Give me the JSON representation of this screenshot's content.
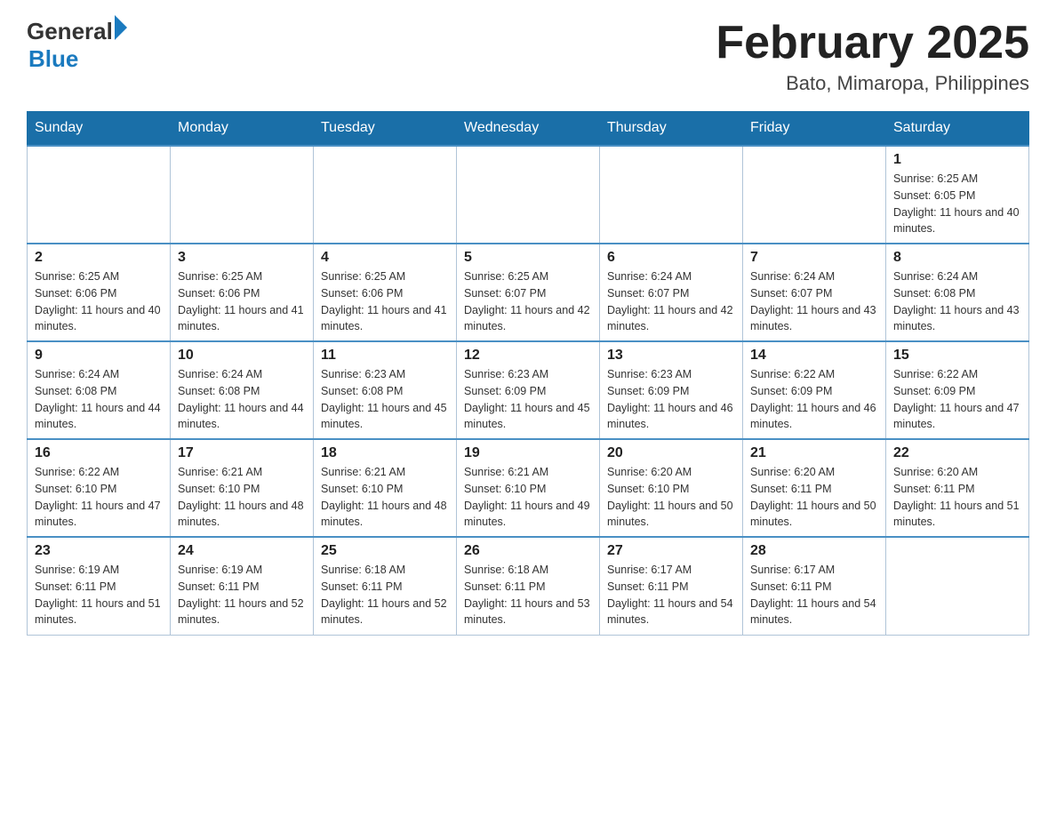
{
  "header": {
    "logo": {
      "general": "General",
      "blue": "Blue"
    },
    "title": "February 2025",
    "location": "Bato, Mimaropa, Philippines"
  },
  "days_of_week": [
    "Sunday",
    "Monday",
    "Tuesday",
    "Wednesday",
    "Thursday",
    "Friday",
    "Saturday"
  ],
  "weeks": [
    [
      {
        "day": "",
        "sunrise": "",
        "sunset": "",
        "daylight": ""
      },
      {
        "day": "",
        "sunrise": "",
        "sunset": "",
        "daylight": ""
      },
      {
        "day": "",
        "sunrise": "",
        "sunset": "",
        "daylight": ""
      },
      {
        "day": "",
        "sunrise": "",
        "sunset": "",
        "daylight": ""
      },
      {
        "day": "",
        "sunrise": "",
        "sunset": "",
        "daylight": ""
      },
      {
        "day": "",
        "sunrise": "",
        "sunset": "",
        "daylight": ""
      },
      {
        "day": "1",
        "sunrise": "Sunrise: 6:25 AM",
        "sunset": "Sunset: 6:05 PM",
        "daylight": "Daylight: 11 hours and 40 minutes."
      }
    ],
    [
      {
        "day": "2",
        "sunrise": "Sunrise: 6:25 AM",
        "sunset": "Sunset: 6:06 PM",
        "daylight": "Daylight: 11 hours and 40 minutes."
      },
      {
        "day": "3",
        "sunrise": "Sunrise: 6:25 AM",
        "sunset": "Sunset: 6:06 PM",
        "daylight": "Daylight: 11 hours and 41 minutes."
      },
      {
        "day": "4",
        "sunrise": "Sunrise: 6:25 AM",
        "sunset": "Sunset: 6:06 PM",
        "daylight": "Daylight: 11 hours and 41 minutes."
      },
      {
        "day": "5",
        "sunrise": "Sunrise: 6:25 AM",
        "sunset": "Sunset: 6:07 PM",
        "daylight": "Daylight: 11 hours and 42 minutes."
      },
      {
        "day": "6",
        "sunrise": "Sunrise: 6:24 AM",
        "sunset": "Sunset: 6:07 PM",
        "daylight": "Daylight: 11 hours and 42 minutes."
      },
      {
        "day": "7",
        "sunrise": "Sunrise: 6:24 AM",
        "sunset": "Sunset: 6:07 PM",
        "daylight": "Daylight: 11 hours and 43 minutes."
      },
      {
        "day": "8",
        "sunrise": "Sunrise: 6:24 AM",
        "sunset": "Sunset: 6:08 PM",
        "daylight": "Daylight: 11 hours and 43 minutes."
      }
    ],
    [
      {
        "day": "9",
        "sunrise": "Sunrise: 6:24 AM",
        "sunset": "Sunset: 6:08 PM",
        "daylight": "Daylight: 11 hours and 44 minutes."
      },
      {
        "day": "10",
        "sunrise": "Sunrise: 6:24 AM",
        "sunset": "Sunset: 6:08 PM",
        "daylight": "Daylight: 11 hours and 44 minutes."
      },
      {
        "day": "11",
        "sunrise": "Sunrise: 6:23 AM",
        "sunset": "Sunset: 6:08 PM",
        "daylight": "Daylight: 11 hours and 45 minutes."
      },
      {
        "day": "12",
        "sunrise": "Sunrise: 6:23 AM",
        "sunset": "Sunset: 6:09 PM",
        "daylight": "Daylight: 11 hours and 45 minutes."
      },
      {
        "day": "13",
        "sunrise": "Sunrise: 6:23 AM",
        "sunset": "Sunset: 6:09 PM",
        "daylight": "Daylight: 11 hours and 46 minutes."
      },
      {
        "day": "14",
        "sunrise": "Sunrise: 6:22 AM",
        "sunset": "Sunset: 6:09 PM",
        "daylight": "Daylight: 11 hours and 46 minutes."
      },
      {
        "day": "15",
        "sunrise": "Sunrise: 6:22 AM",
        "sunset": "Sunset: 6:09 PM",
        "daylight": "Daylight: 11 hours and 47 minutes."
      }
    ],
    [
      {
        "day": "16",
        "sunrise": "Sunrise: 6:22 AM",
        "sunset": "Sunset: 6:10 PM",
        "daylight": "Daylight: 11 hours and 47 minutes."
      },
      {
        "day": "17",
        "sunrise": "Sunrise: 6:21 AM",
        "sunset": "Sunset: 6:10 PM",
        "daylight": "Daylight: 11 hours and 48 minutes."
      },
      {
        "day": "18",
        "sunrise": "Sunrise: 6:21 AM",
        "sunset": "Sunset: 6:10 PM",
        "daylight": "Daylight: 11 hours and 48 minutes."
      },
      {
        "day": "19",
        "sunrise": "Sunrise: 6:21 AM",
        "sunset": "Sunset: 6:10 PM",
        "daylight": "Daylight: 11 hours and 49 minutes."
      },
      {
        "day": "20",
        "sunrise": "Sunrise: 6:20 AM",
        "sunset": "Sunset: 6:10 PM",
        "daylight": "Daylight: 11 hours and 50 minutes."
      },
      {
        "day": "21",
        "sunrise": "Sunrise: 6:20 AM",
        "sunset": "Sunset: 6:11 PM",
        "daylight": "Daylight: 11 hours and 50 minutes."
      },
      {
        "day": "22",
        "sunrise": "Sunrise: 6:20 AM",
        "sunset": "Sunset: 6:11 PM",
        "daylight": "Daylight: 11 hours and 51 minutes."
      }
    ],
    [
      {
        "day": "23",
        "sunrise": "Sunrise: 6:19 AM",
        "sunset": "Sunset: 6:11 PM",
        "daylight": "Daylight: 11 hours and 51 minutes."
      },
      {
        "day": "24",
        "sunrise": "Sunrise: 6:19 AM",
        "sunset": "Sunset: 6:11 PM",
        "daylight": "Daylight: 11 hours and 52 minutes."
      },
      {
        "day": "25",
        "sunrise": "Sunrise: 6:18 AM",
        "sunset": "Sunset: 6:11 PM",
        "daylight": "Daylight: 11 hours and 52 minutes."
      },
      {
        "day": "26",
        "sunrise": "Sunrise: 6:18 AM",
        "sunset": "Sunset: 6:11 PM",
        "daylight": "Daylight: 11 hours and 53 minutes."
      },
      {
        "day": "27",
        "sunrise": "Sunrise: 6:17 AM",
        "sunset": "Sunset: 6:11 PM",
        "daylight": "Daylight: 11 hours and 54 minutes."
      },
      {
        "day": "28",
        "sunrise": "Sunrise: 6:17 AM",
        "sunset": "Sunset: 6:11 PM",
        "daylight": "Daylight: 11 hours and 54 minutes."
      },
      {
        "day": "",
        "sunrise": "",
        "sunset": "",
        "daylight": ""
      }
    ]
  ]
}
